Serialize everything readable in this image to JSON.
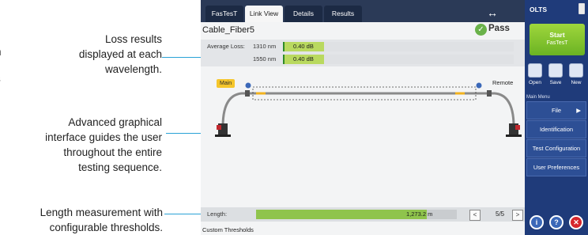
{
  "left_edge_text": [
    "n",
    "s"
  ],
  "callouts": {
    "loss": [
      "Loss results",
      "displayed at each",
      "wavelength."
    ],
    "graphical": [
      "Advanced graphical",
      "interface guides the user",
      "throughout the entire",
      "testing sequence."
    ],
    "length": [
      "Length measurement with",
      "configurable thresholds."
    ]
  },
  "tabs": [
    {
      "label": "FasTesT",
      "active": false
    },
    {
      "label": "Link View",
      "active": true
    },
    {
      "label": "Details",
      "active": false
    },
    {
      "label": "Results",
      "active": false
    }
  ],
  "header": {
    "arrows_icon": "double-arrow-icon",
    "title": "Cable_Fiber5",
    "status": "Pass"
  },
  "loss": {
    "label": "Average Loss:",
    "rows": [
      {
        "wavelength": "1310 nm",
        "value": "0.40 dB"
      },
      {
        "wavelength": "1550 nm",
        "value": "0.40 dB"
      }
    ]
  },
  "link": {
    "main_label": "Main",
    "remote_label": "Remote",
    "end_marker": "0"
  },
  "length": {
    "label": "Length:",
    "value": "1,273.2 m",
    "fill_fraction": 0.85,
    "page": "5/5",
    "prev": "<",
    "next": ">"
  },
  "custom_thresholds": "Custom Thresholds",
  "sidebar": {
    "app": "OLTS",
    "start_label": "Start",
    "start_sub": "FasTesT",
    "tools": [
      {
        "label": "Open",
        "icon": "folder-icon"
      },
      {
        "label": "Save",
        "icon": "save-icon"
      },
      {
        "label": "New",
        "icon": "new-file-icon"
      }
    ],
    "menu_heading": "Main Menu",
    "menu": [
      "File",
      "Identification",
      "Test Configuration",
      "User Preferences"
    ],
    "file_arrow": "▶"
  },
  "colors": {
    "accent": "#2aa2d6",
    "tabbar": "#2b3a57",
    "sidebar": "#1f3b7a",
    "pass": "#6ab24a"
  }
}
